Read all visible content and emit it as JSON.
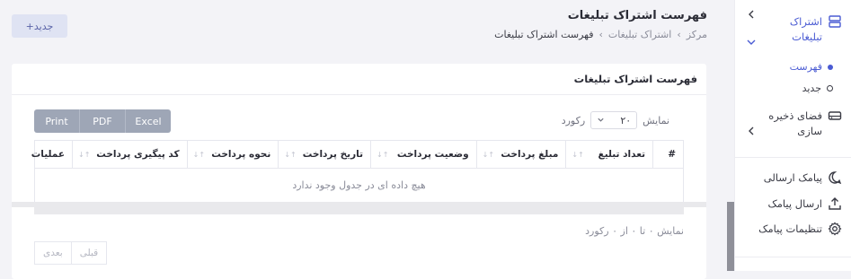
{
  "header": {
    "title": "فهرست اشتراک تبلیغات",
    "breadcrumb": [
      "مرکز",
      "اشتراک تبلیغات",
      "فهرست اشتراک تبلیغات"
    ],
    "breadcrumb_sep": "›",
    "new_button": "+جدید"
  },
  "card": {
    "title": "فهرست اشتراک تبلیغات",
    "export_buttons": [
      "Print",
      "PDF",
      "Excel"
    ],
    "length": {
      "show_label": "نمایش",
      "value": "۲۰",
      "records_label": "رکورد"
    },
    "table": {
      "hash": "#",
      "columns": [
        "تعداد تبلیغ",
        "مبلغ پرداخت",
        "وضعیت پرداخت",
        "تاریخ پرداخت",
        "نحوه پرداخت",
        "کد پیگیری پرداخت",
        "عملیات"
      ],
      "empty_text": "هیچ داده ای در جدول وجود ندارد"
    },
    "info": "نمایش ۰ تا ۰ از ۰ رکورد",
    "pager": {
      "prev": "قبلی",
      "next": "بعدی"
    }
  },
  "sidebar": {
    "ad_subscription": "اشتراک تبلیغات",
    "sub_list": "فهرست",
    "sub_new": "جدید",
    "storage": "فضای ذخیره سازی",
    "sent_sms": "پیامک ارسالی",
    "send_sms": "ارسال پیامک",
    "sms_settings": "تنظیمات پیامک"
  },
  "colors": {
    "accent": "#4a5bd3",
    "export_bg": "#9ea6b6",
    "new_btn_bg": "#dfe3f3"
  }
}
